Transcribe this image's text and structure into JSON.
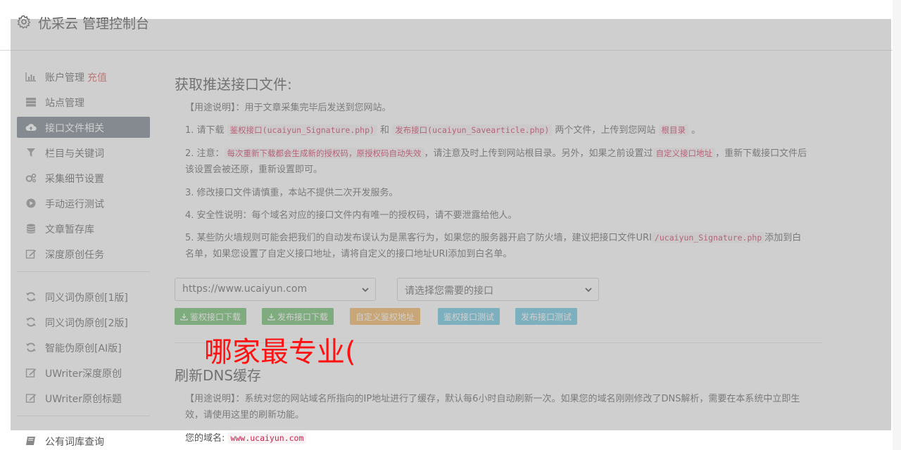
{
  "header": {
    "title": "优采云 管理控制台"
  },
  "sidebar": {
    "items": [
      {
        "label": "账户管理",
        "hot": "充值",
        "icon": "bar-chart-icon"
      },
      {
        "label": "站点管理",
        "icon": "server-icon"
      },
      {
        "label": "接口文件相关",
        "icon": "cloud-upload-icon",
        "active": true
      },
      {
        "label": "栏目与关键词",
        "icon": "filter-icon"
      },
      {
        "label": "采集细节设置",
        "icon": "gears-icon"
      },
      {
        "label": "手动运行测试",
        "icon": "play-circle-icon"
      },
      {
        "label": "文章暂存库",
        "icon": "database-icon"
      },
      {
        "label": "深度原创任务",
        "icon": "edit-icon"
      }
    ],
    "items2": [
      {
        "label": "同义词伪原创[1版]",
        "icon": "refresh-icon"
      },
      {
        "label": "同义词伪原创[2版]",
        "icon": "refresh-icon"
      },
      {
        "label": "智能伪原创[AI版]",
        "icon": "refresh-icon"
      },
      {
        "label": "UWriter深度原创",
        "icon": "edit-icon"
      },
      {
        "label": "UWriter原创标题",
        "icon": "edit-icon"
      }
    ],
    "items3": [
      {
        "label": "公有词库查询",
        "icon": "book-icon"
      }
    ]
  },
  "main": {
    "section1": {
      "title": "获取推送接口文件:",
      "usage": "【用途说明】：用于文章采集完毕后发送到您网站。",
      "p1_a": "1. 请下载 ",
      "p1_code1": "鉴权接口(ucaiyun_Signature.php)",
      "p1_b": " 和 ",
      "p1_code2": "发布接口(ucaiyun_Savearticle.php)",
      "p1_c": " 两个文件，上传到您网站 ",
      "p1_code3": "根目录",
      "p1_d": " 。",
      "p2_a": "2. 注意：",
      "p2_code1": "每次重新下载都会生成新的授权码，原授权码自动失效",
      "p2_b": "，请注意及时上传到网站根目录。另外，如果之前设置过",
      "p2_code2": "自定义接口地址",
      "p2_c": "，重新下载接口文件后该设置会被还原，重新设置即可。",
      "p3": "3. 修改接口文件请慎重，本站不提供二次开发服务。",
      "p4": "4. 安全性说明：每个域名对应的接口文件内有唯一的授权码，请不要泄露给他人。",
      "p5_a": "5. 某些防火墙规则可能会把我们的自动发布误认为是黑客行为，如果您的服务器开启了防火墙，建议把接口文件URI",
      "p5_code": "/ucaiyun_Signature.php",
      "p5_b": "添加到白名单，如果您设置了自定义接口地址，请将自定义的接口地址URI添加到白名单。",
      "site_select": "https://www.ucaiyun.com",
      "api_select": "请选择您需要的接口",
      "buttons": {
        "b1": "鉴权接口下载",
        "b2": "发布接口下载",
        "b3": "自定义鉴权地址",
        "b4": "鉴权接口测试",
        "b5": "发布接口测试"
      }
    },
    "section2": {
      "title": "刷新DNS缓存",
      "usage": "【用途说明】：系统对您的网站域名所指向的IP地址进行了缓存，默认每6小时自动刷新一次。如果您的域名刚刚修改了DNS解析，需要在本系统中立即生效，请使用这里的刷新功能。",
      "domain_label": "您的域名:",
      "domain": "www.ucaiyun.com"
    }
  },
  "overlay_text": "哪家最专业(",
  "colors": {
    "green": "#5cb85c",
    "orange": "#f0ad4e",
    "blue": "#5bc0de",
    "active": "#6b7280",
    "red": "#ff1111"
  }
}
